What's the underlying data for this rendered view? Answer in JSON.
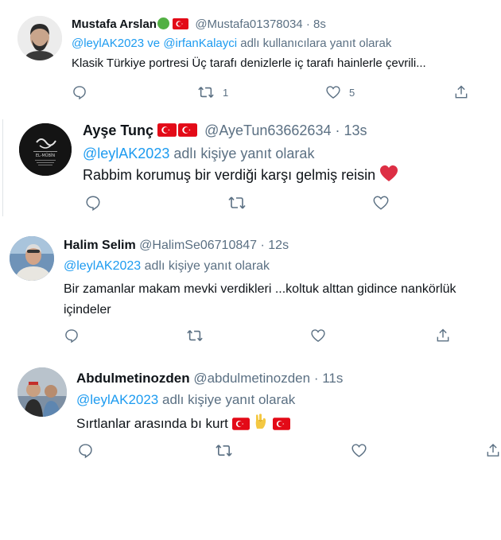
{
  "colors": {
    "link": "#1d9bf0",
    "muted": "#5b7083",
    "text": "#0f1419",
    "flag": "#e30a17"
  },
  "tweets": [
    {
      "name": "Mustafa Arslan",
      "name_badges": [
        "green-circle",
        "turkey-flag"
      ],
      "handle": "@Mustafa01378034",
      "separator": "·",
      "time": "8s",
      "reply_mentions": [
        "@leylAK2023",
        "@irfanKalayci"
      ],
      "reply_joiner": "ve",
      "reply_suffix": "adlı kullanıcılara yanıt olarak",
      "text": "Klasik Türkiye portresi Üç tarafı denizlerle iç tarafı hainlerle çevrili...",
      "actions": {
        "reply": "",
        "retweet": "1",
        "like": "5",
        "share": ""
      }
    },
    {
      "name": "Ayşe Tunç",
      "name_badges": [
        "turkey-flag",
        "turkey-flag"
      ],
      "handle": "@AyeTun63662634",
      "separator": "·",
      "time": "13s",
      "reply_mention": "@leylAK2023",
      "reply_suffix": "adlı kişiye yanıt olarak",
      "text": "Rabbim korumuş bir verdiği karşı gelmiş reisin",
      "text_emoji": "red-heart",
      "avatar_caption": "EL-MÜBİN"
    },
    {
      "name": "Halim Selim",
      "handle": "@HalimSe06710847",
      "separator": "·",
      "time": "12s",
      "reply_mention": "@leylAK2023",
      "reply_suffix": "adlı kişiye yanıt olarak",
      "text": "Bir zamanlar makam mevki verdikleri ...koltuk alttan gidince nankörlük içindeler"
    },
    {
      "name": "Abdulmetinozden",
      "handle": "@abdulmetinozden",
      "separator": "·",
      "time": "11s",
      "reply_mention": "@leylAK2023",
      "reply_suffix": "adlı kişiye yanıt olarak",
      "text": "Sırtlanlar arasında bı kurt",
      "text_emojis": [
        "turkey-flag",
        "wolf-salute-hand",
        "turkey-flag"
      ]
    }
  ]
}
